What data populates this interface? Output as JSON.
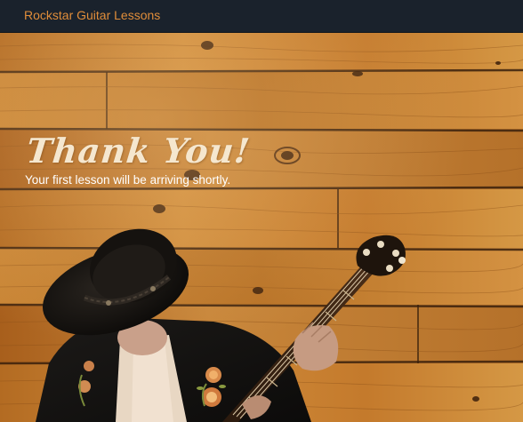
{
  "navbar": {
    "brand": "Rockstar Guitar Lessons"
  },
  "hero": {
    "title": "Thank You!",
    "subtitle": "Your first lesson will be arriving shortly."
  },
  "colors": {
    "navbar_bg": "#1a222c",
    "brand_text": "#e08d3a",
    "wood": "#c07a2a",
    "title_text": "#f5e7cf",
    "subtitle_text": "#ffffff"
  }
}
